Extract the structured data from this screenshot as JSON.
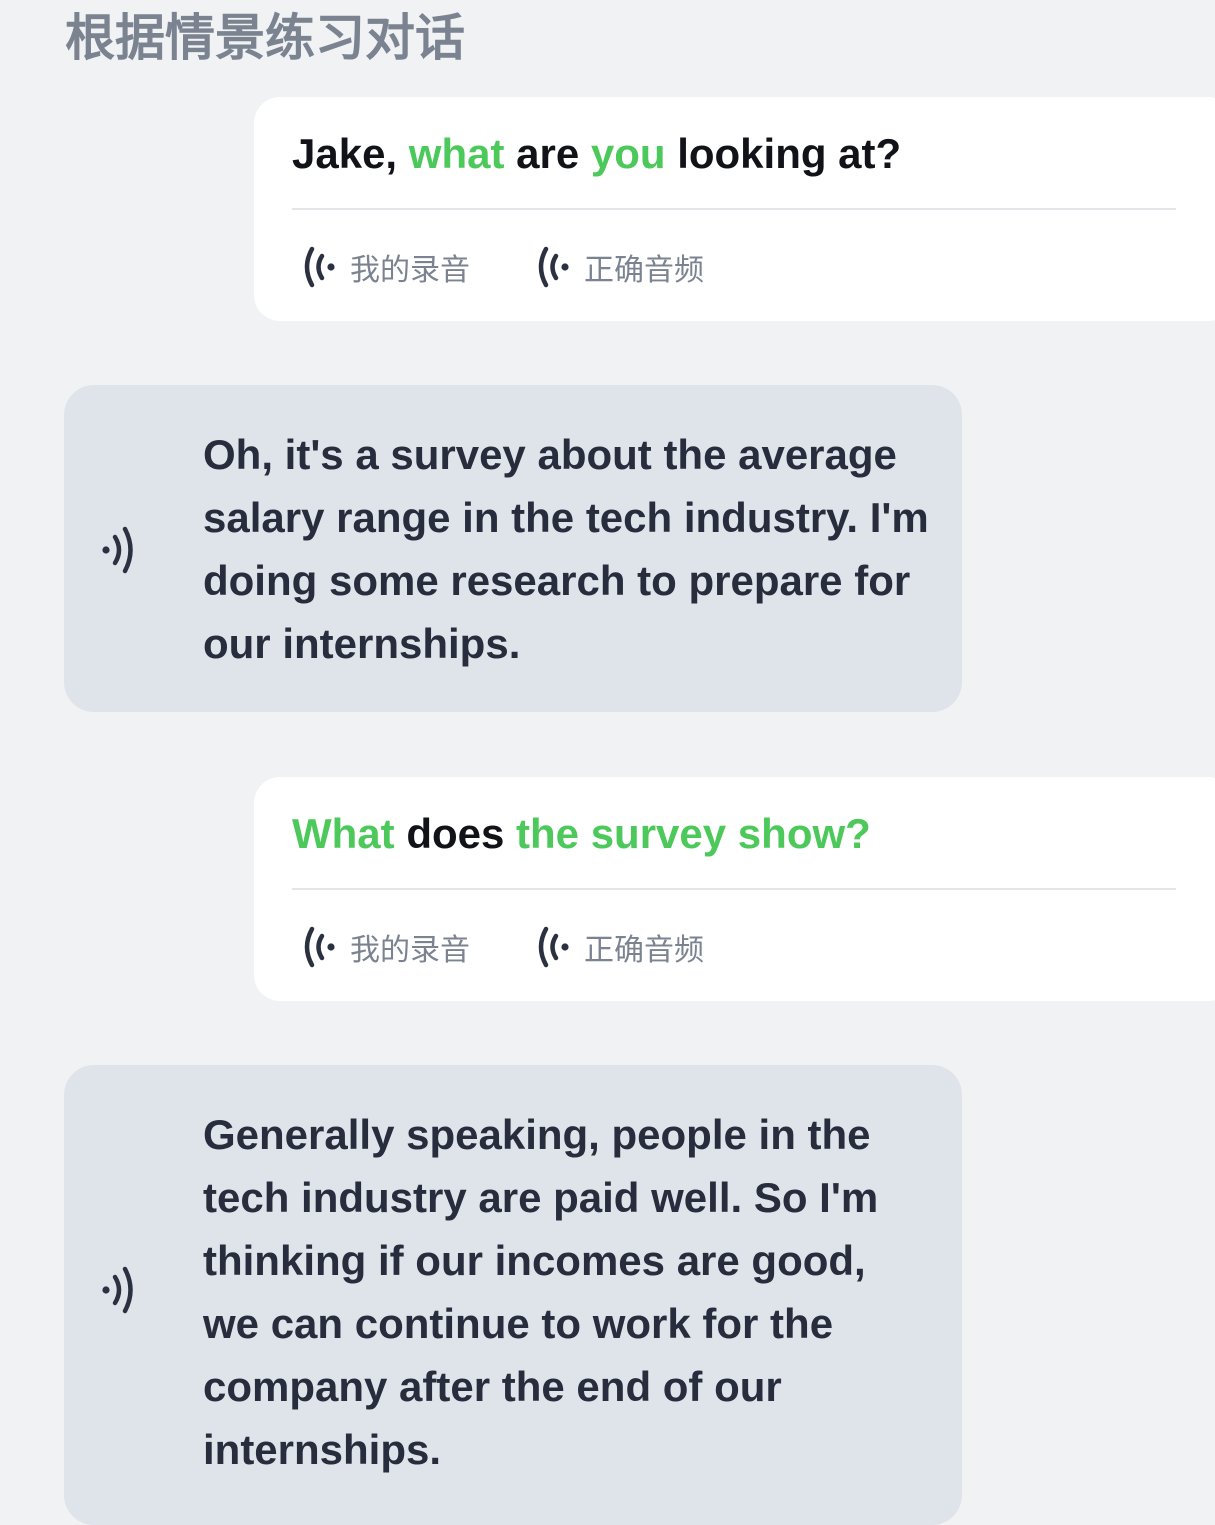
{
  "page": {
    "title": "根据情景练习对话"
  },
  "dialogue": [
    {
      "role": "user",
      "segments": [
        {
          "text": "Jake, ",
          "highlight": false
        },
        {
          "text": "what",
          "highlight": true
        },
        {
          "text": " are ",
          "highlight": false
        },
        {
          "text": "you",
          "highlight": true
        },
        {
          "text": " looking at?",
          "highlight": false
        }
      ],
      "my_recording_label": "我的录音",
      "correct_audio_label": "正确音频"
    },
    {
      "role": "partner",
      "text": "Oh, it's a survey about the average salary range in the tech industry. I'm doing some research to prepare for our internships."
    },
    {
      "role": "user",
      "segments": [
        {
          "text": "What",
          "highlight": true
        },
        {
          "text": " does ",
          "highlight": false
        },
        {
          "text": "the survey show?",
          "highlight": true
        }
      ],
      "my_recording_label": "我的录音",
      "correct_audio_label": "正确音频"
    },
    {
      "role": "partner",
      "text": "Generally speaking, people in the tech industry are paid well. So I'm thinking if our incomes are good, we can continue to work for the company after the end of our internships."
    }
  ],
  "colors": {
    "background": "#f1f2f4",
    "highlight": "#4cc95a",
    "partner_bubble": "#dfe3ea",
    "icon": "#2b3140",
    "muted_text": "#7b8391"
  },
  "icons": {
    "audio_button": "sound-waves-left-icon",
    "speaker": "sound-waves-right-icon"
  }
}
